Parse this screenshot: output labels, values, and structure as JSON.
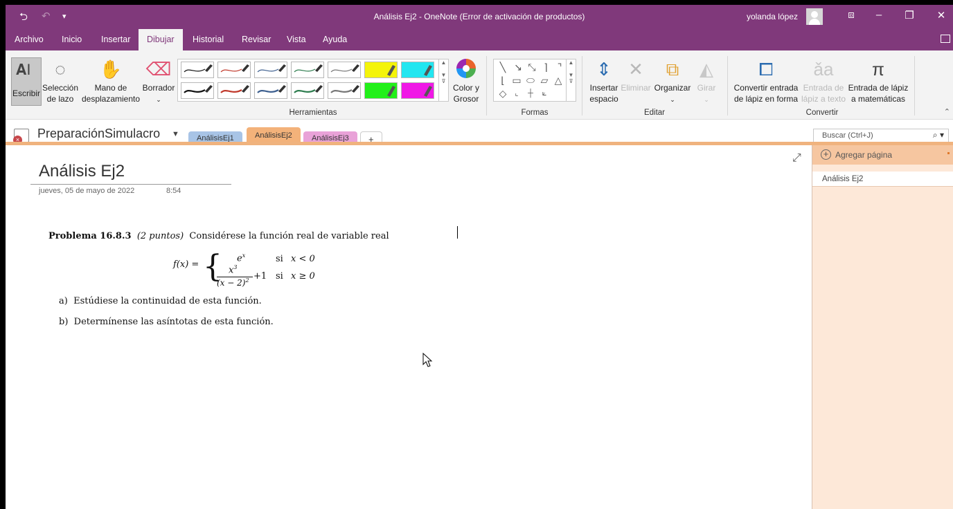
{
  "window": {
    "title": "Análisis Ej2  -  OneNote (Error de activación de productos)",
    "user": "yolanda lópez"
  },
  "menu": {
    "tabs": [
      "Archivo",
      "Inicio",
      "Insertar",
      "Dibujar",
      "Historial",
      "Revisar",
      "Vista",
      "Ayuda"
    ],
    "active": "Dibujar"
  },
  "ribbon": {
    "tools": {
      "escribir": "Escribir",
      "lazo_1": "Selección",
      "lazo_2": "de lazo",
      "mano_1": "Mano de",
      "mano_2": "desplazamiento",
      "borrador": "Borrador",
      "color_1": "Color y",
      "color_2": "Grosor",
      "group": "Herramientas"
    },
    "pens": [
      {
        "color": "#111111",
        "kind": "pen"
      },
      {
        "color": "#c0392b",
        "kind": "pen"
      },
      {
        "color": "#3d5f8f",
        "kind": "pen"
      },
      {
        "color": "#2e7d4f",
        "kind": "pen"
      },
      {
        "color": "#777777",
        "kind": "pen"
      },
      {
        "color": "#f4f40a",
        "kind": "highlighter"
      },
      {
        "color": "#22e6f0",
        "kind": "highlighter"
      },
      {
        "color": "#111111",
        "kind": "pen-thick"
      },
      {
        "color": "#c0392b",
        "kind": "pen-thick"
      },
      {
        "color": "#3d5f8f",
        "kind": "pen-thick"
      },
      {
        "color": "#2e7d4f",
        "kind": "pen-thick"
      },
      {
        "color": "#777777",
        "kind": "pen-thick"
      },
      {
        "color": "#22f01a",
        "kind": "highlighter"
      },
      {
        "color": "#f018e6",
        "kind": "highlighter"
      }
    ],
    "formas_group": "Formas",
    "editar": {
      "insertar_1": "Insertar",
      "insertar_2": "espacio",
      "eliminar": "Eliminar",
      "organizar": "Organizar",
      "girar": "Girar",
      "group": "Editar"
    },
    "convertir": {
      "forma_1": "Convertir entrada",
      "forma_2": "de lápiz en forma",
      "texto_1": "Entrada de",
      "texto_2": "lápiz a texto",
      "mate_1": "Entrada de lápiz",
      "mate_2": "a matemáticas",
      "group": "Convertir"
    }
  },
  "notebook": {
    "name": "PreparaciónSimulacro",
    "sections": [
      {
        "label": "AnálisisEj1",
        "color": "#a8c4e6"
      },
      {
        "label": "AnálisisEj2",
        "color": "#f3b27a"
      },
      {
        "label": "AnálisisEj3",
        "color": "#e9a2d8"
      }
    ],
    "add_section": "+",
    "search_placeholder": "Buscar (Ctrl+J)"
  },
  "page": {
    "title": "Análisis Ej2",
    "date": "jueves, 05 de mayo de 2022",
    "time": "8:54",
    "problem": {
      "label": "Problema 16.8.3",
      "points": "(2 puntos)",
      "statement": "Considérese la función real de variable real",
      "fx": "f(x) =",
      "case1_expr": "e",
      "case1_exp": "x",
      "case1_si": "si",
      "case1_cond": "x < 0",
      "case2_num": "x",
      "case2_num_exp": "3",
      "case2_den": "(x − 2)",
      "case2_den_exp": "2",
      "case2_plus": "+1",
      "case2_si": "si",
      "case2_cond": "x ≥ 0",
      "a_label": "a)",
      "a_text": "Estúdiese la continuidad de esta función.",
      "b_label": "b)",
      "b_text": "Determínense las asíntotas de esta función."
    }
  },
  "pages_panel": {
    "add_page": "Agregar página",
    "pages": [
      "Análisis Ej2"
    ]
  }
}
